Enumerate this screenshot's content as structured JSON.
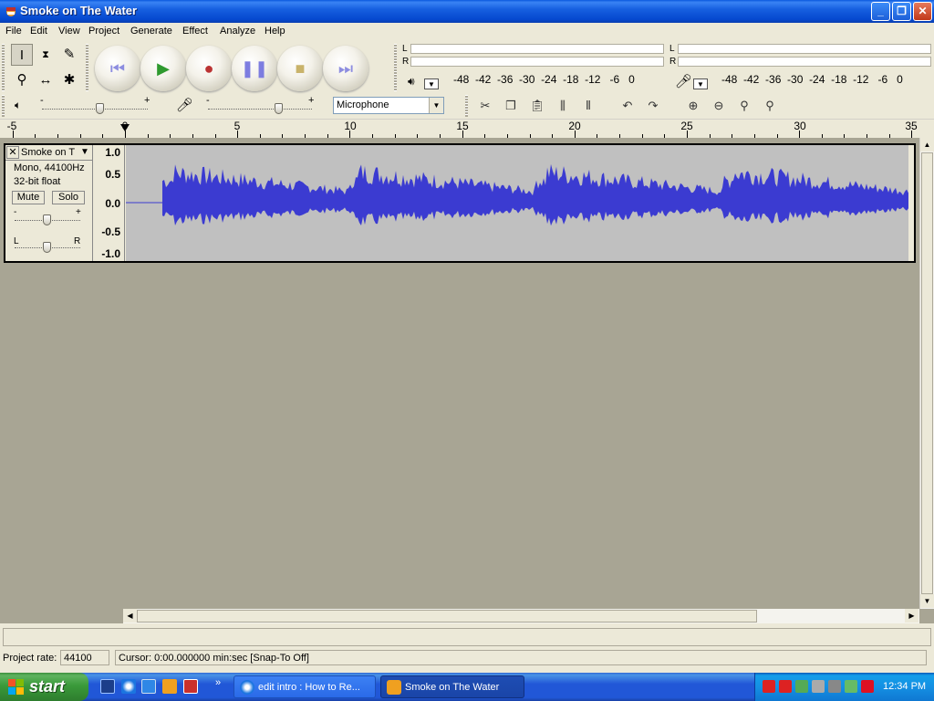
{
  "window": {
    "title": "Smoke on The Water"
  },
  "menu": [
    "File",
    "Edit",
    "View",
    "Project",
    "Generate",
    "Effect",
    "Analyze",
    "Help"
  ],
  "meters": {
    "playback": {
      "l": "L",
      "r": "R"
    },
    "record": {
      "l": "L",
      "r": "R"
    },
    "scale": [
      "-48",
      "-42",
      "-36",
      "-30",
      "-24",
      "-18",
      "-12",
      "-6",
      "0"
    ]
  },
  "mixer": {
    "minus": "-",
    "plus": "+",
    "input_source": "Microphone"
  },
  "ruler": {
    "labels": [
      "-5",
      "0",
      "5",
      "10",
      "15",
      "20",
      "25",
      "30",
      "35"
    ]
  },
  "track": {
    "name": "Smoke on T",
    "format": "Mono, 44100Hz",
    "bitdepth": "32-bit float",
    "mute": "Mute",
    "solo": "Solo",
    "gain_minus": "-",
    "gain_plus": "+",
    "pan_left": "L",
    "pan_right": "R",
    "scale": [
      "1.0",
      "0.5",
      "0.0",
      "-0.5",
      "-1.0"
    ],
    "wave_color": "#3b3bd1"
  },
  "status": {
    "rate_label": "Project rate:",
    "rate_value": "44100",
    "cursor": "Cursor: 0:00.000000 min:sec   [Snap-To Off]"
  },
  "taskbar": {
    "start": "start",
    "chevron": "»",
    "tasks": [
      {
        "label": "edit intro : How to Re..."
      },
      {
        "label": "Smoke on The Water"
      }
    ],
    "clock": "12:34 PM"
  },
  "colors": {
    "title_blue": "#0a58de",
    "face": "#ece9d8",
    "workspace": "#a8a594"
  }
}
